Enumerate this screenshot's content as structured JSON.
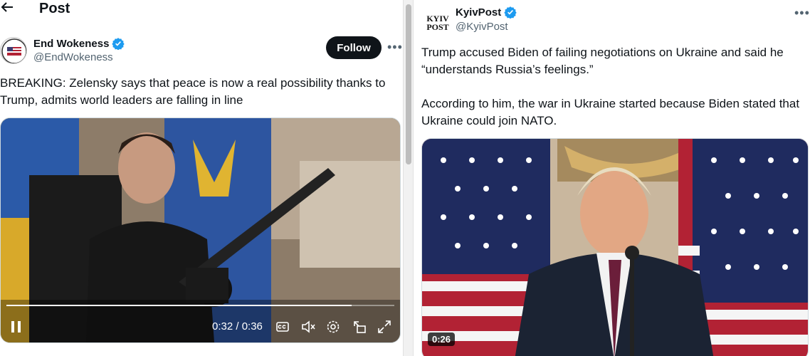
{
  "left": {
    "header": {
      "title": "Post"
    },
    "author": {
      "name": "End Wokeness",
      "handle": "@EndWokeness"
    },
    "follow_label": "Follow",
    "post_text": "BREAKING: Zelensky says that peace is now a real possibility thanks to Trump, admits world leaders are falling in line",
    "video": {
      "time": "0:32 / 0:36",
      "progress": 0.89
    }
  },
  "right": {
    "author": {
      "name": "KyivPost",
      "handle": "@KyivPost",
      "logo_line1": "KYIV",
      "logo_line2": "POST"
    },
    "paragraph1": "Trump accused Biden of failing negotiations on Ukraine and said he “understands Russia’s feelings.”",
    "paragraph2": "According to him, the war in Ukraine started because Biden stated that Ukraine could join NATO.",
    "video": {
      "duration_badge": "0:26"
    }
  },
  "colors": {
    "verified": "#1d9bf0",
    "text": "#0f1419",
    "secondary": "#536471"
  },
  "icons": [
    "back-arrow-icon",
    "verified-icon",
    "more-icon",
    "pause-icon",
    "captions-icon",
    "mute-icon",
    "settings-icon",
    "pip-icon",
    "fullscreen-icon"
  ]
}
